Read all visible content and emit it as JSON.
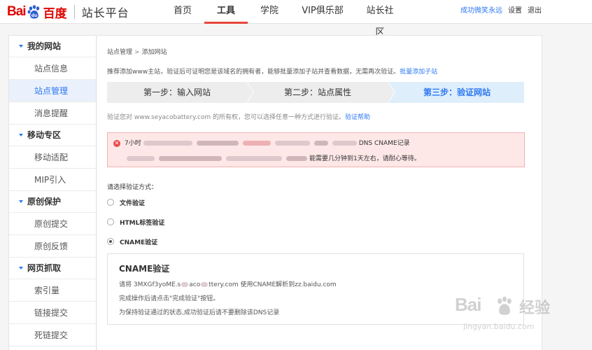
{
  "header": {
    "logo_bai": "Bai",
    "logo_cn": "百度",
    "product": "站长平台",
    "nav": [
      {
        "label": "首页",
        "active": false
      },
      {
        "label": "工具",
        "active": true
      },
      {
        "label": "学院",
        "active": false
      },
      {
        "label": "VIP俱乐部",
        "active": false
      },
      {
        "label": "站长社区",
        "active": false
      }
    ],
    "user": "成功微笑永远",
    "settings": "设置",
    "logout": "退出"
  },
  "sidebar": {
    "groups": [
      {
        "title": "我的网站",
        "items": [
          {
            "label": "站点信息",
            "active": false
          },
          {
            "label": "站点管理",
            "active": true
          },
          {
            "label": "消息提醒",
            "active": false
          }
        ]
      },
      {
        "title": "移动专区",
        "items": [
          {
            "label": "移动适配",
            "active": false
          },
          {
            "label": "MIP引入",
            "active": false
          }
        ]
      },
      {
        "title": "原创保护",
        "items": [
          {
            "label": "原创提交",
            "active": false
          },
          {
            "label": "原创反馈",
            "active": false
          }
        ]
      },
      {
        "title": "网页抓取",
        "items": [
          {
            "label": "索引量",
            "active": false
          },
          {
            "label": "链接提交",
            "active": false
          },
          {
            "label": "死链提交",
            "active": false
          }
        ]
      }
    ]
  },
  "main": {
    "breadcrumb": [
      "站点管理",
      "添加网站"
    ],
    "breadcrumb_sep": ">",
    "intro_text": "推荐添加www主站，验证后可证明您是该域名的拥有者，能够批量添加子站并查看数据，无需再次验证。",
    "intro_link": "批量添加子站",
    "steps": [
      {
        "label": "第一步：输入网站",
        "active": false
      },
      {
        "label": "第二步：站点属性",
        "active": false
      },
      {
        "label": "第三步：验证网站",
        "active": true
      }
    ],
    "verify_desc": "验证您对 www.seyacobattery.com 的所有权，您可以选择任意一种方式进行验证。",
    "verify_help": "验证帮助",
    "alert": {
      "line1_start": "7小时",
      "line1_end": "DNS CNAME记录",
      "line2_end": "能需要几分钟到1天左右，请耐心等待。"
    },
    "method_label": "请选择验证方式：",
    "methods": [
      {
        "label": "文件验证",
        "checked": false
      },
      {
        "label": "HTML标签验证",
        "checked": false
      },
      {
        "label": "CNAME验证",
        "checked": true
      }
    ],
    "cname": {
      "title": "CNAME验证",
      "line1_a": "请将 3MXGf3yoME.s",
      "line1_b": "aco",
      "line1_c": "ttery.com 使用CNAME解析到zz.baidu.com",
      "line2": "完成操作后请点击\"完成验证\"按钮。",
      "line3": "为保持验证通过的状态,成功验证后请不要删除该DNS记录"
    }
  },
  "watermark": {
    "logo": "Bai",
    "cn": "经验",
    "url": "jingyan.baidu.com"
  },
  "colors": {
    "brand_red": "#e10601",
    "link_blue": "#2d78f4",
    "active_tab_underline": "#e8453c",
    "alert_bg": "#fde7e7",
    "step_active_bg": "#deeefb"
  }
}
